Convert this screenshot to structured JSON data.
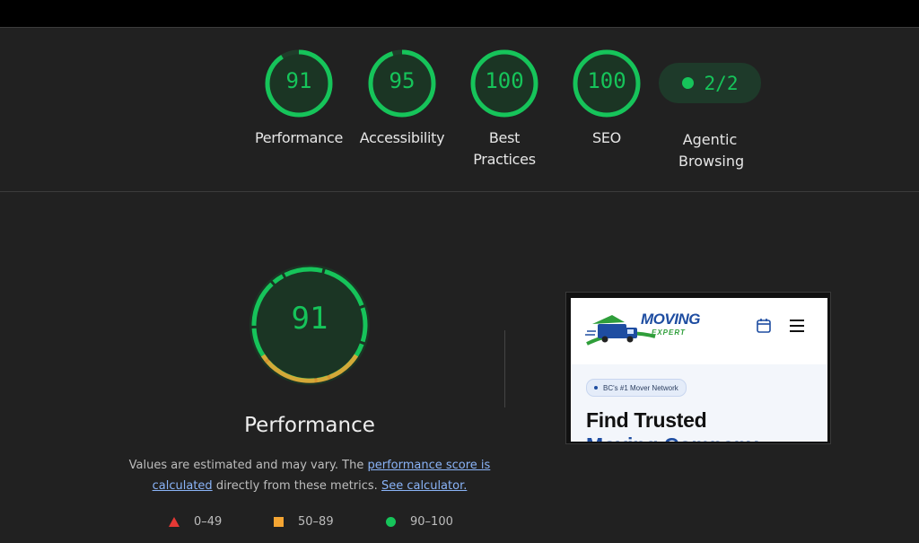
{
  "categories": [
    {
      "label": "Performance",
      "score": "91",
      "value": 91
    },
    {
      "label": "Accessibility",
      "score": "95",
      "value": 95
    },
    {
      "label": "Best Practices",
      "score": "100",
      "value": 100
    },
    {
      "label": "SEO",
      "score": "100",
      "value": 100
    }
  ],
  "agentic": {
    "label": "Agentic Browsing",
    "value": "2/2"
  },
  "main": {
    "score": "91",
    "value": 91,
    "title": "Performance",
    "desc_prefix": "Values are estimated and may vary. The ",
    "link_score": "performance score is calculated",
    "desc_mid": " directly from these metrics. ",
    "link_calc": "See calculator."
  },
  "legend": [
    {
      "range": "0–49",
      "shape": "triangle",
      "color": "#e53935"
    },
    {
      "range": "50–89",
      "shape": "square",
      "color": "#f4a533"
    },
    {
      "range": "90–100",
      "shape": "circle",
      "color": "#16c45a"
    }
  ],
  "preview": {
    "logo_word": "MOVING",
    "logo_sub": "EXPERT",
    "badge": "BC's #1 Mover Network",
    "headline": "Find Trusted",
    "headline2": "Moving Company",
    "icons": [
      "calendar-icon",
      "hamburger-menu-icon"
    ]
  },
  "colors": {
    "pass": "#16c45a",
    "average": "#f4a533",
    "fail": "#e53935",
    "link": "#8ab4f8"
  }
}
